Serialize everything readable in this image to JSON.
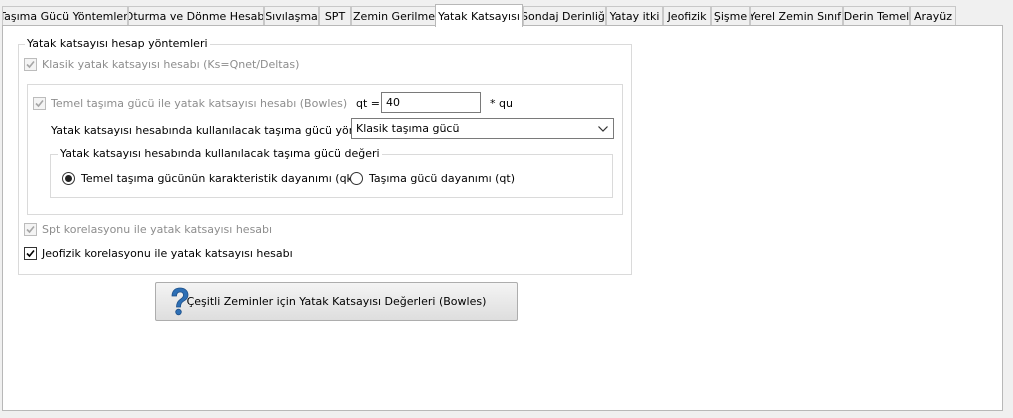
{
  "tabs": [
    {
      "label": "Taşıma Gücü Yöntemleri"
    },
    {
      "label": "Oturma ve Dönme Hesabı"
    },
    {
      "label": "Sıvılaşma"
    },
    {
      "label": "SPT"
    },
    {
      "label": "Zemin Gerilme"
    },
    {
      "label": "Yatak Katsayısı"
    },
    {
      "label": "Sondaj Derinliği"
    },
    {
      "label": "Yatay itki"
    },
    {
      "label": "Jeofizik"
    },
    {
      "label": "Şişme"
    },
    {
      "label": "Yerel Zemin Sınıfı"
    },
    {
      "label": "Derin Temel"
    },
    {
      "label": "Arayüz"
    }
  ],
  "active_tab": "Yatak Katsayısı",
  "methods_group": {
    "legend": "Yatak katsayısı hesap yöntemleri",
    "classic": {
      "label": "Klasik yatak katsayısı hesabı (Ks=Qnet/Deltas)",
      "checked": true,
      "enabled": false
    },
    "bowles": {
      "label": "Temel taşıma gücü ile yatak katsayısı hesabı (Bowles)",
      "checked": true,
      "enabled": false,
      "qt_label": "qt =",
      "qt_value": "40",
      "qt_unit": "* qu",
      "method_label": "Yatak katsayısı hesabında kullanılacak taşıma gücü yöntemi",
      "method_value": "Klasik taşıma gücü",
      "value_group": {
        "legend": "Yatak katsayısı hesabında kullanılacak taşıma gücü değeri",
        "option_qk": {
          "label": "Temel taşıma gücünün karakteristik dayanımı (qk)",
          "selected": true
        },
        "option_qt": {
          "label": "Taşıma gücü dayanımı (qt)",
          "selected": false
        }
      }
    },
    "spt": {
      "label": "Spt korelasyonu ile yatak katsayısı hesabı",
      "checked": true,
      "enabled": false
    },
    "geophysics": {
      "label": "Jeofizik korelasyonu ile yatak katsayısı hesabı",
      "checked": true,
      "enabled": true
    }
  },
  "bowles_button": {
    "label": "Çeşitli Zeminler için Yatak Katsayısı  Değerleri (Bowles)",
    "icon": "question-icon"
  },
  "colors": {
    "check_disabled": "#a6a6a6",
    "check_enabled": "#000000",
    "icon_blue": "#2d6fb5"
  }
}
